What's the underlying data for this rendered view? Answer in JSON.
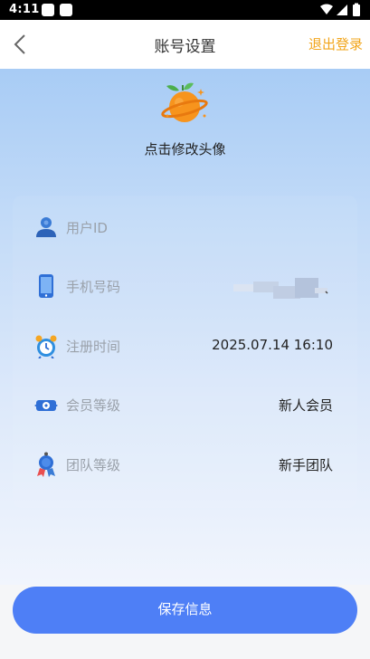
{
  "status_bar": {
    "time": "4:11"
  },
  "header": {
    "title": "账号设置",
    "logout_label": "退出登录",
    "back_icon": "chevron-left-icon"
  },
  "avatar": {
    "label": "点击修改头像",
    "icon": "orange-planet-avatar"
  },
  "rows": [
    {
      "label": "用户ID",
      "value": "",
      "icon": "user-icon"
    },
    {
      "label": "手机号码",
      "value": "",
      "icon": "phone-icon"
    },
    {
      "label": "注册时间",
      "value": "2025.07.14 16:10",
      "icon": "alarm-clock-icon"
    },
    {
      "label": "会员等级",
      "value": "新人会员",
      "icon": "member-badge-icon"
    },
    {
      "label": "团队等级",
      "value": "新手团队",
      "icon": "medal-icon"
    }
  ],
  "footer": {
    "save_label": "保存信息"
  },
  "colors": {
    "accent": "#4e7ff6",
    "logout": "#f2a51b"
  }
}
